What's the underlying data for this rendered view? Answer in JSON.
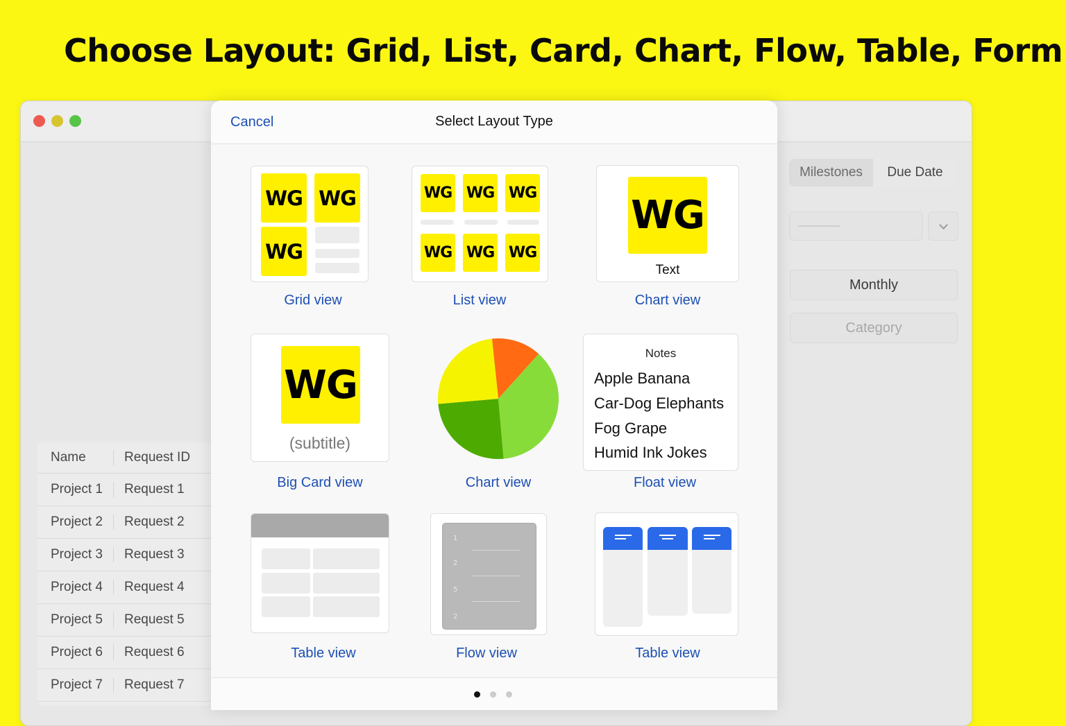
{
  "headline": "Choose Layout: Grid, List, Card, Chart, Flow, Table, Form",
  "window": {
    "segmented": [
      "Milestones",
      "Due Date"
    ],
    "monthly_button": "Monthly",
    "category_button": "Category",
    "table": {
      "headers": [
        "Name",
        "Request ID"
      ],
      "rows": [
        [
          "Project 1",
          "Request 1"
        ],
        [
          "Project 2",
          "Request 2"
        ],
        [
          "Project 3",
          "Request 3"
        ],
        [
          "Project 4",
          "Request 4"
        ],
        [
          "Project 5",
          "Request 5"
        ],
        [
          "Project 6",
          "Request 6"
        ],
        [
          "Project 7",
          "Request 7"
        ]
      ]
    }
  },
  "modal": {
    "cancel_label": "Cancel",
    "title": "Select Layout Type",
    "options": [
      {
        "label": "Grid view"
      },
      {
        "label": "List view"
      },
      {
        "label": "Chart view",
        "caption": "Text"
      },
      {
        "label": "Big Card view",
        "caption": "(subtitle)"
      },
      {
        "label": "Chart view"
      },
      {
        "label": "Float view",
        "notes_title": "Notes",
        "notes": [
          "Apple Banana",
          "Car-Dog Elephants",
          "Fog Grape",
          "Humid Ink Jokes"
        ]
      },
      {
        "label": "Table view"
      },
      {
        "label": "Flow view",
        "numbers": [
          "1",
          "2",
          "5",
          "2"
        ]
      },
      {
        "label": "Table view"
      }
    ],
    "logo_text": "WG",
    "pager": {
      "count": 3,
      "active": 1
    }
  },
  "colors": {
    "background": "#fbf713",
    "link": "#1c4fb3",
    "logo_yellow": "#fff000",
    "pie": [
      "#ff6a13",
      "#88dc39",
      "#4daa00",
      "#f6f300"
    ],
    "kanban_blue": "#2a6ae8"
  }
}
